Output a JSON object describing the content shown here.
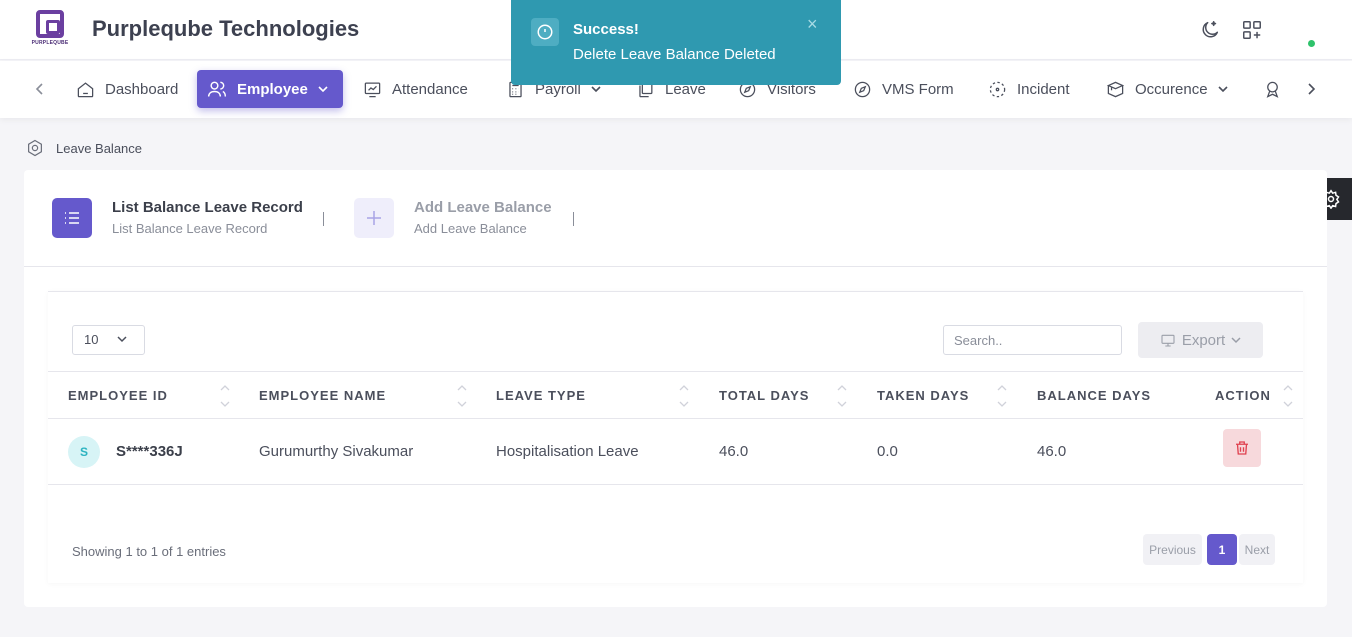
{
  "header": {
    "brand_name": "Purpleqube Technologies",
    "logo_text": "PURPLEQUBE",
    "icons": [
      "moon-icon",
      "grid-plus-icon"
    ],
    "status_color": "#2ec26b"
  },
  "nav": {
    "items": [
      {
        "label": "Dashboard",
        "icon": "home-icon"
      },
      {
        "label": "Employee",
        "icon": "users-icon",
        "active": true,
        "dropdown": true
      },
      {
        "label": "Attendance",
        "icon": "chart-icon"
      },
      {
        "label": "Payroll",
        "icon": "calculator-icon",
        "dropdown": true
      },
      {
        "label": "Leave",
        "icon": "copy-icon"
      },
      {
        "label": "Visitors",
        "icon": "compass-icon"
      },
      {
        "label": "VMS Form",
        "icon": "compass-icon"
      },
      {
        "label": "Incident",
        "icon": "focus-icon"
      },
      {
        "label": "Occurence",
        "icon": "box-icon",
        "dropdown": true
      }
    ],
    "accent": "#6559cc"
  },
  "toast": {
    "title": "Success!",
    "message": "Delete Leave Balance Deleted",
    "close": "×",
    "color": "#2f99b0"
  },
  "breadcrumb": {
    "current": "Leave Balance"
  },
  "wizard": {
    "steps": [
      {
        "title": "List Balance Leave Record",
        "subtitle": "List Balance Leave Record",
        "active": true
      },
      {
        "title": "Add Leave Balance",
        "subtitle": "Add Leave Balance",
        "active": false
      }
    ]
  },
  "table_controls": {
    "page_length": "10",
    "search_placeholder": "Search..",
    "export_label": "Export"
  },
  "table": {
    "columns": [
      "EMPLOYEE ID",
      "EMPLOYEE NAME",
      "LEAVE TYPE",
      "TOTAL DAYS",
      "TAKEN DAYS",
      "BALANCE DAYS",
      "ACTION"
    ],
    "rows": [
      {
        "avatar": "S",
        "employee_id": "S****336J",
        "employee_name": "Gurumurthy Sivakumar",
        "leave_type": "Hospitalisation Leave",
        "total_days": "46.0",
        "taken_days": "0.0",
        "balance_days": "46.0"
      }
    ]
  },
  "pagination": {
    "info": "Showing 1 to 1 of 1 entries",
    "previous": "Previous",
    "current": "1",
    "next": "Next"
  }
}
